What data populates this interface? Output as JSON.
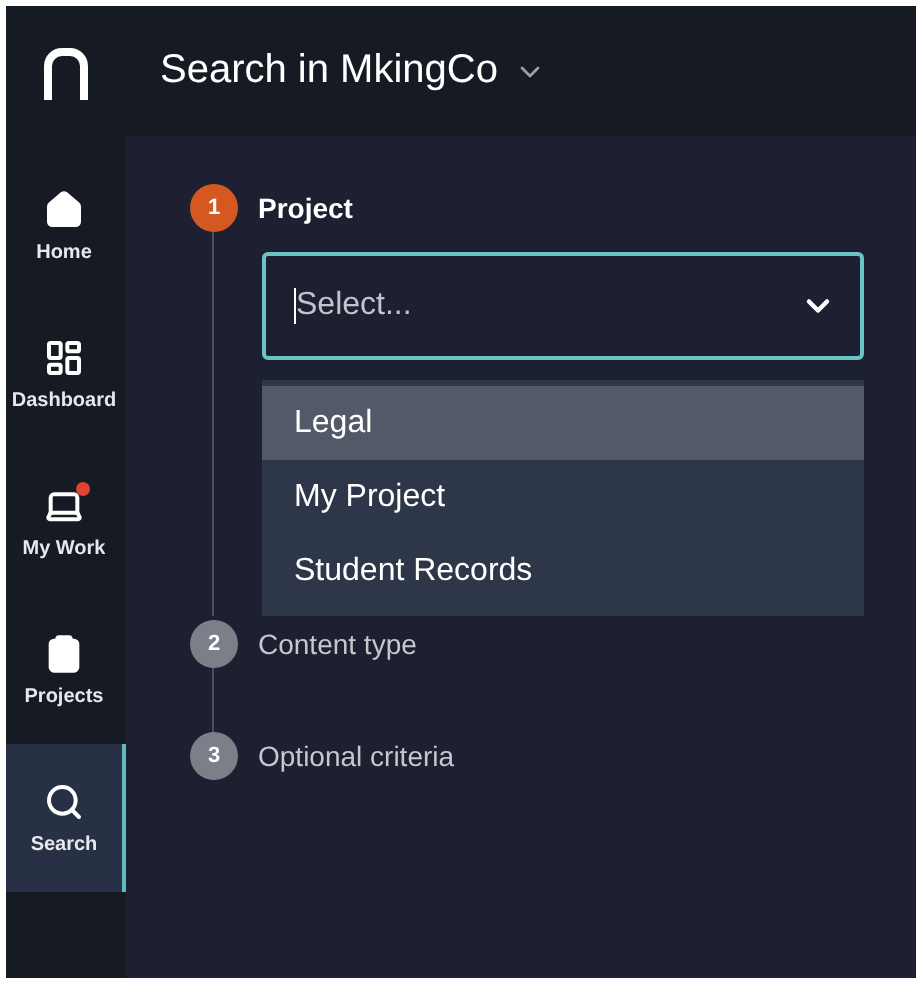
{
  "header": {
    "title": "Search in MkingCo"
  },
  "sidebar": {
    "items": [
      {
        "label": "Home",
        "selected": false,
        "notification": false
      },
      {
        "label": "Dashboard",
        "selected": false,
        "notification": false
      },
      {
        "label": "My Work",
        "selected": false,
        "notification": true
      },
      {
        "label": "Projects",
        "selected": false,
        "notification": false
      },
      {
        "label": "Search",
        "selected": true,
        "notification": false
      }
    ]
  },
  "steps": [
    {
      "number": "1",
      "label": "Project",
      "active": true
    },
    {
      "number": "2",
      "label": "Content type",
      "active": false
    },
    {
      "number": "3",
      "label": "Optional criteria",
      "active": false
    }
  ],
  "project_select": {
    "placeholder": "Select...",
    "options": [
      {
        "label": "Legal",
        "highlighted": true
      },
      {
        "label": "My Project",
        "highlighted": false
      },
      {
        "label": "Student Records",
        "highlighted": false
      }
    ]
  }
}
